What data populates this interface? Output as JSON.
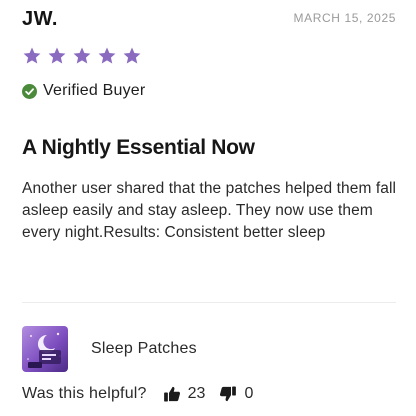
{
  "review": {
    "reviewer_name": "JW.",
    "date": "MARCH 15, 2025",
    "rating": 5,
    "max_rating": 5,
    "star_color": "#8a6bbf",
    "verified_label": "Verified Buyer",
    "verified_color": "#4a8a3a",
    "title": "A Nightly Essential Now",
    "body": "Another user shared that the patches helped them fall asleep easily and stay asleep. They now use them every night.Results: Consistent better sleep"
  },
  "product": {
    "name": "Sleep Patches",
    "thumbnail_icon": "sleep-patches-thumbnail"
  },
  "helpful": {
    "label": "Was this helpful?",
    "up_count": "23",
    "down_count": "0",
    "up_icon": "thumbs-up-icon",
    "down_icon": "thumbs-down-icon"
  }
}
